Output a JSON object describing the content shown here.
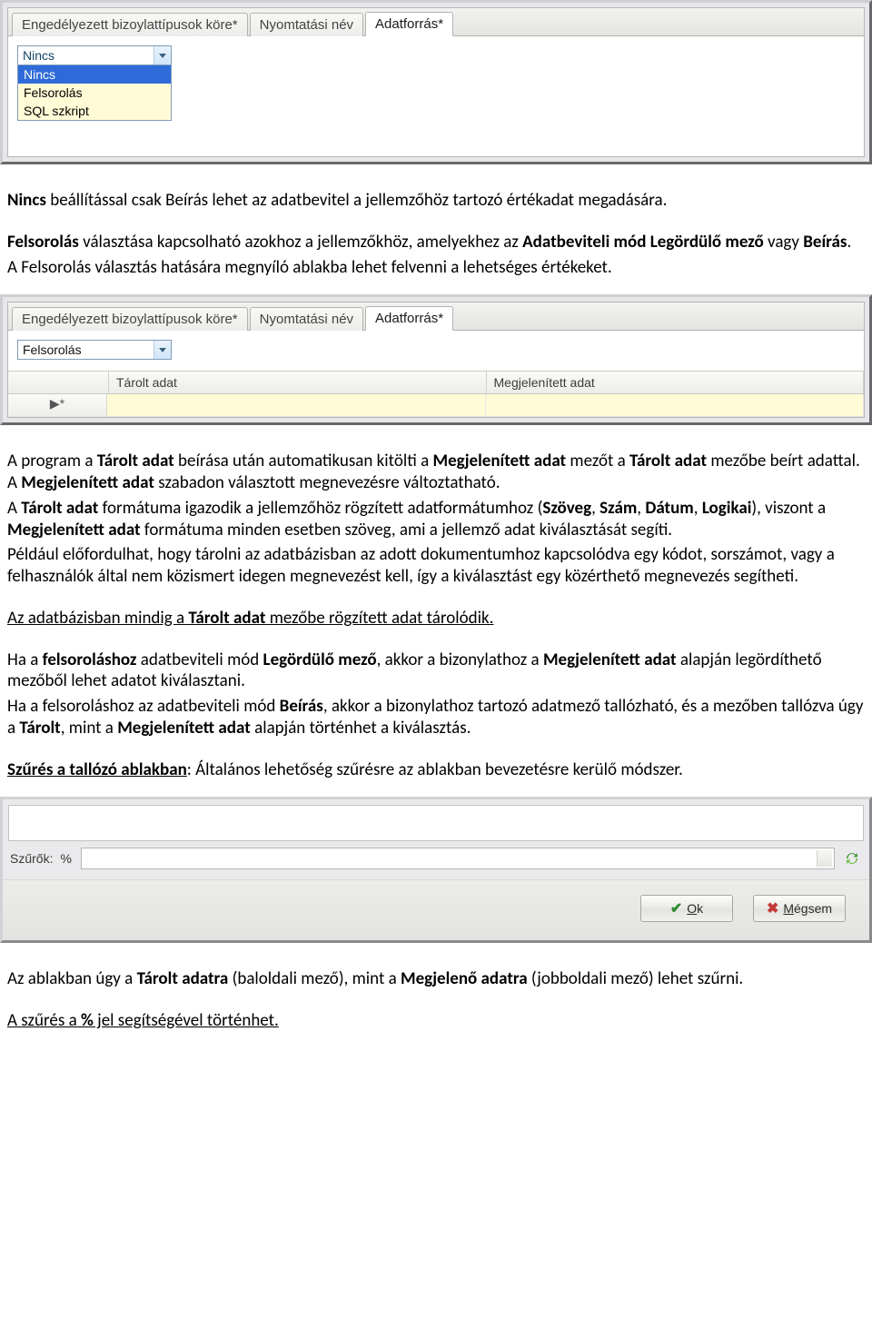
{
  "shot1": {
    "tabs": [
      "Engedélyezett bizoylattípusok köre*",
      "Nyomtatási név",
      "Adatforrás*"
    ],
    "active_tab_index": 2,
    "combo_value": "Nincs",
    "options": [
      "Nincs",
      "Felsorolás",
      "SQL szkript"
    ],
    "selected_option_index": 0
  },
  "para1_a": "Nincs",
  "para1_b": " beállítással csak Beírás lehet az adatbevitel a jellemzőhöz tartozó értékadat megadására.",
  "para2_a": "Felsorolás",
  "para2_b": " választása kapcsolható azokhoz a jellemzőkhöz, amelyekhez az ",
  "para2_c": "Adatbeviteli mód Legördülő mező",
  "para2_d": " vagy ",
  "para2_e": "Beírás",
  "para2_f": ".",
  "para3": "A Felsorolás választás hatására megnyíló ablakba lehet felvenni a lehetséges értékeket.",
  "shot2": {
    "tabs": [
      "Engedélyezett bizoylattípusok köre*",
      "Nyomtatási név",
      "Adatforrás*"
    ],
    "active_tab_index": 2,
    "combo_value": "Felsorolás",
    "col1": "Tárolt adat",
    "col2": "Megjelenített adat",
    "rowhandle": "▶*"
  },
  "para4_a": "A program a ",
  "para4_b": "Tárolt adat",
  "para4_c": " beírása után automatikusan kitölti a ",
  "para4_d": "Megjelenített adat",
  "para4_e": " mezőt a ",
  "para4_f": "Tárolt adat",
  "para4_g": " mezőbe beírt adattal. A ",
  "para4_h": "Megjelenített adat",
  "para4_i": " szabadon választott megnevezésre változtatható.",
  "para5_a": "A ",
  "para5_b": "Tárolt adat",
  "para5_c": " formátuma igazodik a jellemzőhöz rögzített adatformátumhoz (",
  "para5_d": "Szöveg",
  "para5_e": ", ",
  "para5_f": "Szám",
  "para5_g": ", ",
  "para5_h": "Dátum",
  "para5_i": ", ",
  "para5_j": "Logikai",
  "para5_k": "), viszont a ",
  "para5_l": "Megjelenített adat",
  "para5_m": " formátuma minden esetben szöveg, ami a jellemző adat kiválasztását segíti.",
  "para6": "Például előfordulhat, hogy tárolni az adatbázisban az adott dokumentumhoz kapcsolódva egy kódot, sorszámot, vagy a felhasználók által nem közismert idegen megnevezést kell, így a kiválasztást egy közérthető megnevezés segítheti.",
  "para7_a": "Az adatbázisban mindig a ",
  "para7_b": "Tárolt adat",
  "para7_c": " mezőbe rögzített adat tárolódik.",
  "para8_a": "Ha a ",
  "para8_b": "felsoroláshoz",
  "para8_c": " adatbeviteli mód ",
  "para8_d": "Legördülő mező",
  "para8_e": ", akkor a bizonylathoz a ",
  "para8_f": "Megjelenített adat",
  "para8_g": " alapján legördíthető mezőből lehet adatot kiválasztani.",
  "para9_a": "Ha a felsoroláshoz az adatbeviteli mód ",
  "para9_b": "Beírás",
  "para9_c": ", akkor a bizonylathoz tartozó adatmező tallózható, és a mezőben tallózva úgy a ",
  "para9_d": "Tárolt",
  "para9_e": ", mint a ",
  "para9_f": "Megjelenített adat",
  "para9_g": " alapján történhet a kiválasztás.",
  "para10_a": "Szűrés a tallózó ablakban",
  "para10_b": ": Általános lehetőség szűrésre az ablakban bevezetésre kerülő módszer.",
  "shot3": {
    "filter_label": "Szűrők:",
    "filter_value": "%",
    "ok": "Ok",
    "cancel": "Mégsem"
  },
  "para11_a": "Az ablakban úgy a ",
  "para11_b": "Tárolt adatra",
  "para11_c": " (baloldali mező), mint a ",
  "para11_d": "Megjelenő adatra",
  "para11_e": " (jobboldali mező) lehet szűrni.",
  "para12_a": "A szűrés a ",
  "para12_b": "%",
  "para12_c": " jel segítségével történhet."
}
